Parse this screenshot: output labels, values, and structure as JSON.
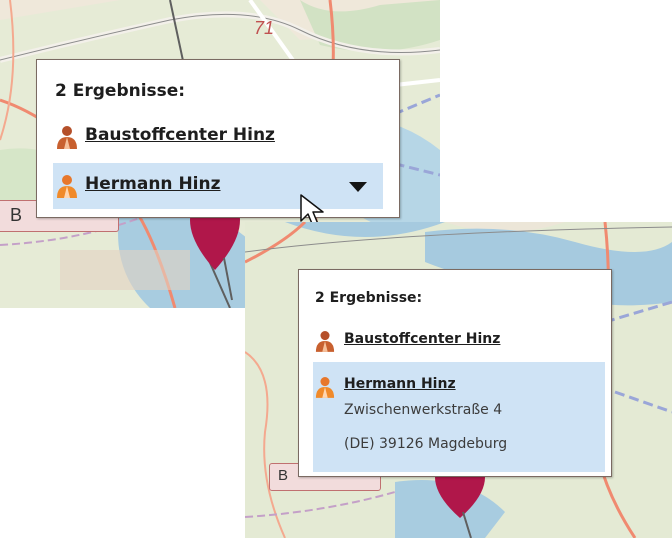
{
  "map_top": {
    "road_label": "B",
    "road_number_fragment": "71",
    "popup": {
      "title": "2 Ergebnisse:",
      "results": [
        {
          "name": "Baustoffcenter Hinz",
          "icon": "person-icon",
          "selected": false
        },
        {
          "name": "Hermann Hinz",
          "icon": "person-icon",
          "selected": true,
          "expand_icon": "caret-down-icon"
        }
      ]
    },
    "cursor_icon": "arrow-cursor-icon"
  },
  "map_bottom": {
    "road_label": "B",
    "popup": {
      "title": "2 Ergebnisse:",
      "results": [
        {
          "name": "Baustoffcenter Hinz",
          "icon": "person-icon",
          "selected": false
        },
        {
          "name": "Hermann Hinz",
          "icon": "person-icon",
          "selected": true,
          "address_line1": "Zwischenwerkstraße 4",
          "address_line2": "(DE) 39126 Magdeburg"
        }
      ]
    }
  },
  "colors": {
    "selection": "#cfe3f5",
    "marker": "#b0174a",
    "popup_border": "#7a6a62"
  }
}
